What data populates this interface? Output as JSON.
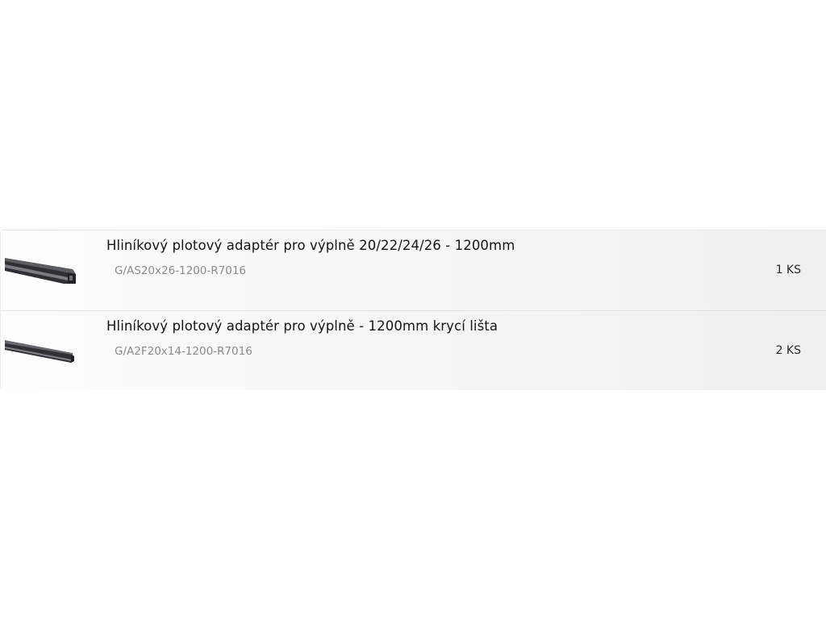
{
  "order_items": [
    {
      "image_icon": "aluminium-adapter-profile-image",
      "name": "Hliníkový plotový adaptér pro výplně 20/22/24/26 - 1200mm",
      "code": "G/AS20x26-1200-R7016",
      "quantity": "1 KS"
    },
    {
      "image_icon": "aluminium-cover-strip-image",
      "name": "Hliníkový plotový adaptér pro výplně - 1200mm krycí lišta",
      "code": "G/A2F20x14-1200-R7016",
      "quantity": "2 KS"
    }
  ],
  "colors": {
    "profile": "#3a3c3f",
    "name_text": "#141414",
    "code_text": "#8a8a8a"
  }
}
